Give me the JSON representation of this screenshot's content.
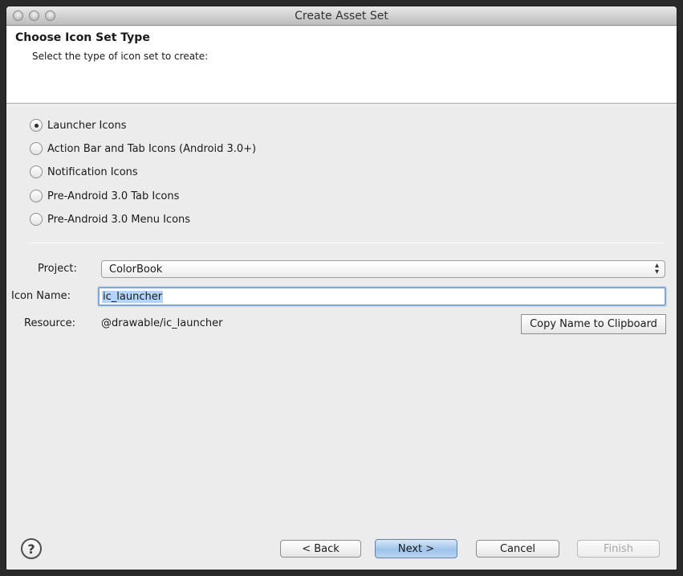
{
  "window": {
    "title": "Create Asset Set"
  },
  "banner": {
    "title": "Choose Icon Set Type",
    "subtitle": "Select the type of icon set to create:"
  },
  "icon_types": [
    {
      "label": "Launcher Icons",
      "selected": true
    },
    {
      "label": "Action Bar and Tab Icons (Android 3.0+)",
      "selected": false
    },
    {
      "label": "Notification Icons",
      "selected": false
    },
    {
      "label": "Pre-Android 3.0 Tab Icons",
      "selected": false
    },
    {
      "label": "Pre-Android 3.0 Menu Icons",
      "selected": false
    }
  ],
  "form": {
    "project_label": "Project:",
    "project_value": "ColorBook",
    "icon_name_label": "Icon Name:",
    "icon_name_value": "ic_launcher",
    "resource_label": "Resource:",
    "resource_value": "@drawable/ic_launcher",
    "copy_button": "Copy Name to Clipboard"
  },
  "footer": {
    "help_icon": "question-mark-icon",
    "back": "< Back",
    "next": "Next >",
    "cancel": "Cancel",
    "finish": "Finish"
  },
  "colors": {
    "selection": "#b3d4fc",
    "focus_ring": "#7fa8d9",
    "default_button": "#9fc3ea"
  }
}
